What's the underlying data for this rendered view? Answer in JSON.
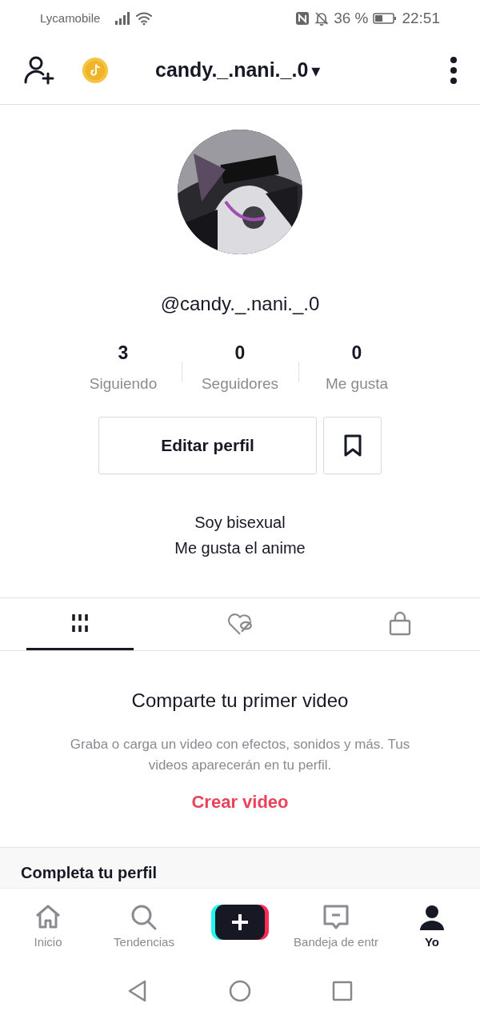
{
  "status_bar": {
    "carrier": "Lycamobile",
    "battery_text": "36 %",
    "time": "22:51"
  },
  "header": {
    "username": "candy._.nani._.0",
    "dropdown_glyph": "▾"
  },
  "profile": {
    "avatar": {
      "kind": "picture"
    },
    "handle": "@candy._.nani._.0",
    "stats": [
      {
        "value": "3",
        "label": "Siguiendo"
      },
      {
        "value": "0",
        "label": "Seguidores"
      },
      {
        "value": "0",
        "label": "Me gusta"
      }
    ],
    "edit_button": "Editar perfil",
    "bio": [
      "Soy bisexual",
      "Me gusta el anime"
    ]
  },
  "tabs": [
    {
      "kind": "videos",
      "selected": true
    },
    {
      "kind": "liked",
      "selected": false
    },
    {
      "kind": "private",
      "selected": false
    }
  ],
  "empty_state": {
    "title": "Comparte tu primer video",
    "text": "Graba o carga un video con efectos, sonidos y más. Tus videos aparecerán en tu perfil.",
    "link": "Crear video"
  },
  "complete_card": {
    "title": "Completa tu perfil"
  },
  "bottom_nav": [
    {
      "kind": "home",
      "label": "Inicio",
      "selected": false
    },
    {
      "kind": "search",
      "label": "Tendencias",
      "selected": false
    },
    {
      "kind": "create"
    },
    {
      "kind": "inbox",
      "label": "Bandeja de entr",
      "selected": false
    },
    {
      "kind": "me",
      "label": "Yo",
      "selected": true
    }
  ]
}
